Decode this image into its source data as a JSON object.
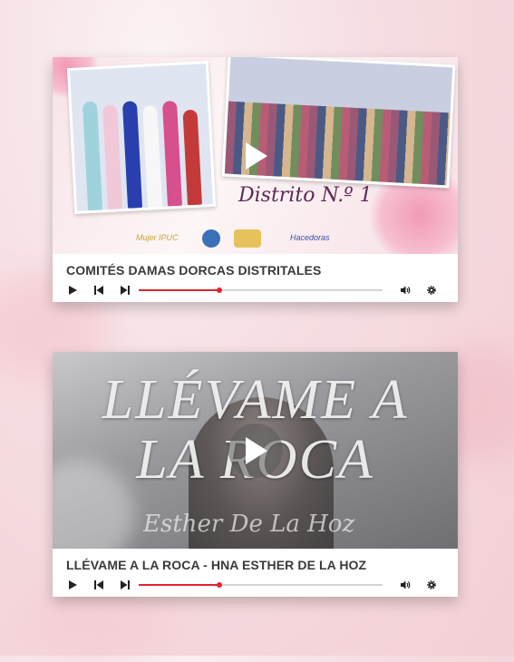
{
  "players": [
    {
      "title": "COMITÉS DAMAS DORCAS DISTRITALES",
      "thumbnail": {
        "script_text": "Distrito N.º 1",
        "logos": [
          "Mujer IPUC",
          "Hacedoras"
        ]
      },
      "progress_fraction": 0.33
    },
    {
      "title": "LLÉVAME A LA ROCA - HNA ESTHER DE LA HOZ",
      "thumbnail": {
        "line1": "LLÉVAME A",
        "line2": "LA ROCA",
        "signature": "Esther De La Hoz"
      },
      "progress_fraction": 0.33
    }
  ],
  "icons": [
    "play-icon",
    "previous-track-icon",
    "next-track-icon",
    "volume-icon",
    "settings-gear-icon"
  ],
  "colors": {
    "accent": "#e0252e",
    "track": "#d4d4d4",
    "title": "#3a3a3a"
  }
}
